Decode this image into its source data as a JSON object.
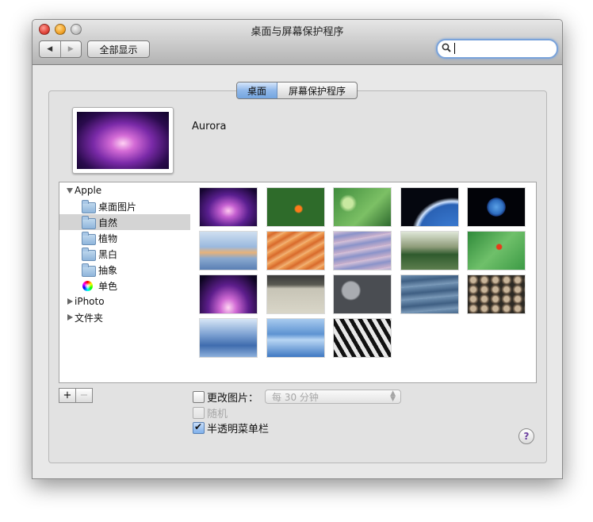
{
  "window": {
    "title": "桌面与屏幕保护程序"
  },
  "toolbar": {
    "back_label": "◀",
    "forward_label": "▶",
    "show_all_label": "全部显示",
    "search_placeholder": ""
  },
  "tabs": [
    {
      "label": "桌面",
      "selected": true
    },
    {
      "label": "屏幕保护程序",
      "selected": false
    }
  ],
  "current_wallpaper": {
    "name": "Aurora"
  },
  "sidebar": {
    "items": [
      {
        "label": "Apple",
        "kind": "group",
        "expanded": true
      },
      {
        "label": "桌面图片",
        "kind": "folder"
      },
      {
        "label": "自然",
        "kind": "folder",
        "selected": true
      },
      {
        "label": "植物",
        "kind": "folder"
      },
      {
        "label": "黑白",
        "kind": "folder"
      },
      {
        "label": "抽象",
        "kind": "folder"
      },
      {
        "label": "单色",
        "kind": "colors"
      },
      {
        "label": "iPhoto",
        "kind": "group",
        "expanded": false
      },
      {
        "label": "文件夹",
        "kind": "group",
        "expanded": false
      }
    ]
  },
  "thumbnails": [
    "aurora",
    "clownfish",
    "dew-leaf",
    "earth-horizon",
    "earth-globe",
    "sunset-water",
    "sandstone-waves",
    "ripple-water",
    "pagoda-garden",
    "ladybug-leaf",
    "aurora-alt",
    "zen-garden",
    "grey-stones",
    "blue-waves",
    "pebbles",
    "blue-reflection",
    "blue-water",
    "zebra"
  ],
  "list_buttons": {
    "add_label": "+",
    "remove_label": "−"
  },
  "options": {
    "change_picture_label": "更改图片：",
    "change_picture_checked": false,
    "interval_value": "每 30 分钟",
    "random_label": "随机",
    "random_checked": false,
    "translucent_menubar_label": "半透明菜单栏",
    "translucent_menubar_checked": true
  },
  "help_label": "?",
  "colors": {
    "accent": "#74a5e0",
    "selection": "#d4d4d4"
  }
}
